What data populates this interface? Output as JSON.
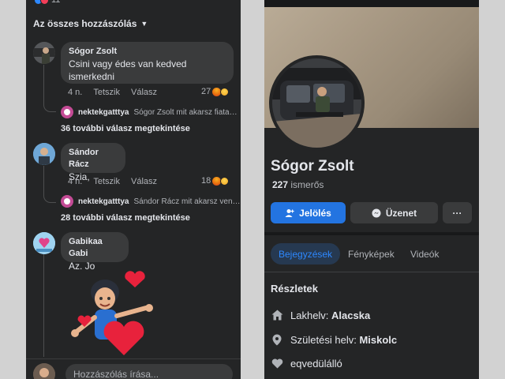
{
  "comments_panel": {
    "top_reaction_count": "11",
    "filter_label": "Az összes hozzászólás",
    "comments": [
      {
        "author": "Sógor Zsolt",
        "text": "Csini vagy édes van kedved ismerkedni",
        "time": "4 n.",
        "like": "Tetszik",
        "reply": "Válasz",
        "reaction_count": "27",
        "sub_reply_author": "nektekgatttya",
        "sub_reply_text": "Sógor Zsolt mit akarsz fiata…",
        "more_replies": "36 további válasz megtekintése"
      },
      {
        "author": "Sándor Rácz",
        "text": "Szia,",
        "time": "4 n.",
        "like": "Tetszik",
        "reply": "Válasz",
        "reaction_count": "18",
        "sub_reply_author": "nektekgatttya",
        "sub_reply_text": "Sándor Rácz mit akarsz ven…",
        "more_replies": "28 további válasz megtekintése"
      },
      {
        "author": "Gabikaa Gabi",
        "text": "Az. Jo"
      }
    ],
    "comment_placeholder": "Hozzászólás írása..."
  },
  "profile_panel": {
    "name": "Sógor Zsolt",
    "friend_count": "227",
    "friends_label": "ismerős",
    "buttons": {
      "tag": "Jelölés",
      "message": "Üzenet",
      "more": "···"
    },
    "tabs": [
      "Bejegyzések",
      "Fényképek",
      "Videók"
    ],
    "details_title": "Részletek",
    "details": [
      {
        "icon": "home-icon",
        "prefix": "Lakhelv:",
        "value": "Alacska"
      },
      {
        "icon": "location-pin-icon",
        "prefix": "Születési helv:",
        "value": "Miskolc"
      },
      {
        "icon": "heart-icon",
        "prefix": "eqvedülálló",
        "value": ""
      }
    ]
  },
  "colors": {
    "panel_bg": "#242526",
    "bubble_bg": "#3a3b3c",
    "accent": "#2374e1",
    "outer_bg": "#d2d2d2"
  }
}
